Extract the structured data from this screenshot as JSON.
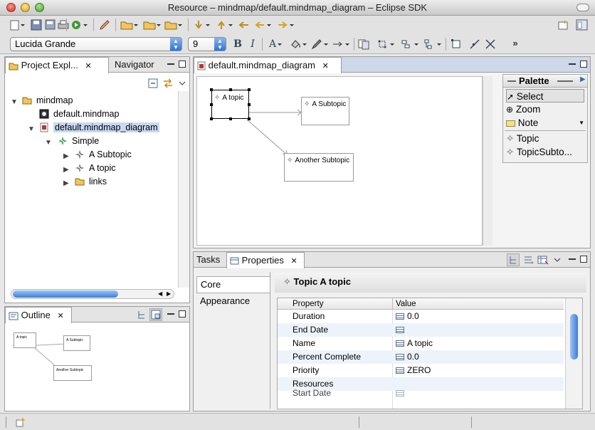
{
  "window": {
    "title": "Resource – mindmap/default.mindmap_diagram – Eclipse SDK"
  },
  "toolbar": {
    "font_family": "Lucida Grande",
    "font_size": "9",
    "bold_label": "B",
    "italic_label": "I",
    "font_color_label": "A",
    "more_label": "»"
  },
  "project_explorer": {
    "tab_label": "Project Expl...",
    "navigator_tab_label": "Navigator",
    "tree": [
      {
        "label": "mindmap"
      },
      {
        "label": "default.mindmap"
      },
      {
        "label": "default.mindmap_diagram"
      },
      {
        "label": "Simple"
      },
      {
        "label": "A Subtopic"
      },
      {
        "label": "A topic"
      },
      {
        "label": "links"
      }
    ]
  },
  "outline": {
    "tab_label": "Outline",
    "nodes": [
      "A topic",
      "A Subtopic",
      "Another Subtopic"
    ]
  },
  "editor": {
    "tab_label": "default.mindmap_diagram",
    "nodes": [
      {
        "label": "A topic"
      },
      {
        "label": "A Subtopic"
      },
      {
        "label": "Another Subtopic"
      }
    ]
  },
  "palette": {
    "title": "Palette",
    "tools": [
      "Select",
      "Zoom",
      "Note"
    ],
    "items": [
      "Topic",
      "TopicSubto..."
    ]
  },
  "bottom_tabs": {
    "tasks_label": "Tasks",
    "properties_label": "Properties"
  },
  "properties": {
    "categories": [
      "Core",
      "Appearance"
    ],
    "header": "Topic A topic",
    "columns": [
      "Property",
      "Value"
    ],
    "rows": [
      {
        "name": "Duration",
        "value": "0.0"
      },
      {
        "name": "End Date",
        "value": ""
      },
      {
        "name": "Name",
        "value": "A topic"
      },
      {
        "name": "Percent Complete",
        "value": "0.0"
      },
      {
        "name": "Priority",
        "value": "ZERO"
      },
      {
        "name": "Resources",
        "value": ""
      },
      {
        "name": "Start Date",
        "value": ""
      }
    ]
  },
  "colors": {
    "selection": "#c7d9f3",
    "accent": "#2f73d7"
  }
}
